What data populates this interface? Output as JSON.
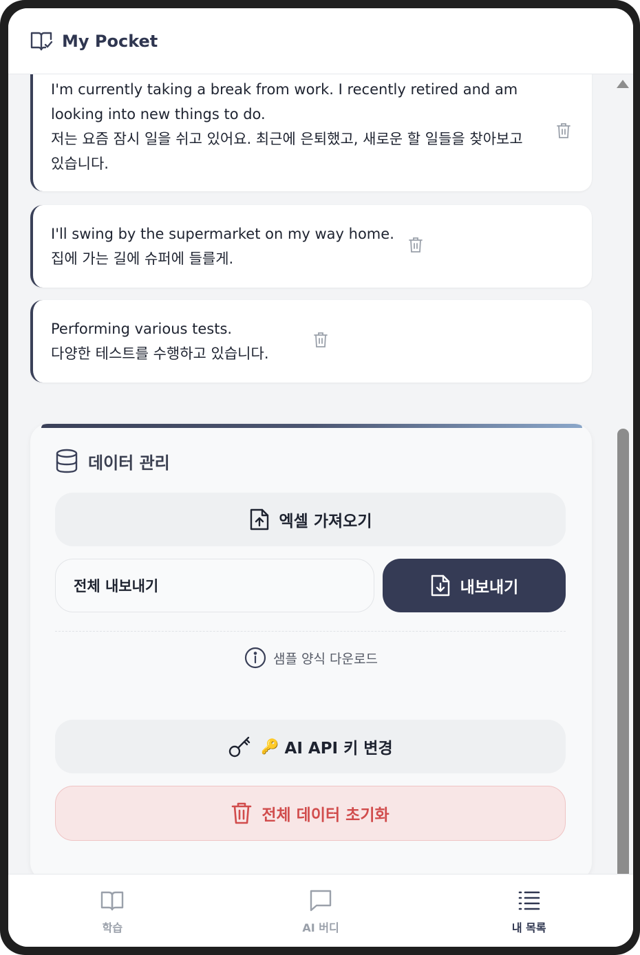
{
  "header": {
    "title": "My Pocket"
  },
  "cards": [
    {
      "en": "I'm currently taking a break from work. I recently retired and am looking into new things to do.",
      "ko": "저는 요즘 잠시 일을 쉬고 있어요. 최근에 은퇴했고, 새로운 할 일들을 찾아보고 있습니다."
    },
    {
      "en": "I'll swing by the supermarket on my way home.",
      "ko": "집에 가는 길에 슈퍼에 들를게."
    },
    {
      "en": "Performing various tests.",
      "ko": "다양한 테스트를 수행하고 있습니다."
    }
  ],
  "data_section": {
    "title": "데이터 관리",
    "import_label": "엑셀 가져오기",
    "export_scope": "전체 내보내기",
    "export_label": "내보내기",
    "sample_label": "샘플 양식 다운로드",
    "api_emoji": "🔑",
    "api_label": "AI API 키 변경",
    "reset_label": "전체 데이터 초기화"
  },
  "nav": {
    "items": [
      {
        "label": "학습",
        "icon": "book-icon"
      },
      {
        "label": "AI 버디",
        "icon": "chat-icon"
      },
      {
        "label": "내 목록",
        "icon": "list-icon"
      }
    ],
    "active": "내 목록"
  },
  "colors": {
    "accent": "#353b55",
    "danger": "#d14c4c",
    "danger_bg": "#f8e6e6",
    "muted": "#9aa0aa"
  }
}
